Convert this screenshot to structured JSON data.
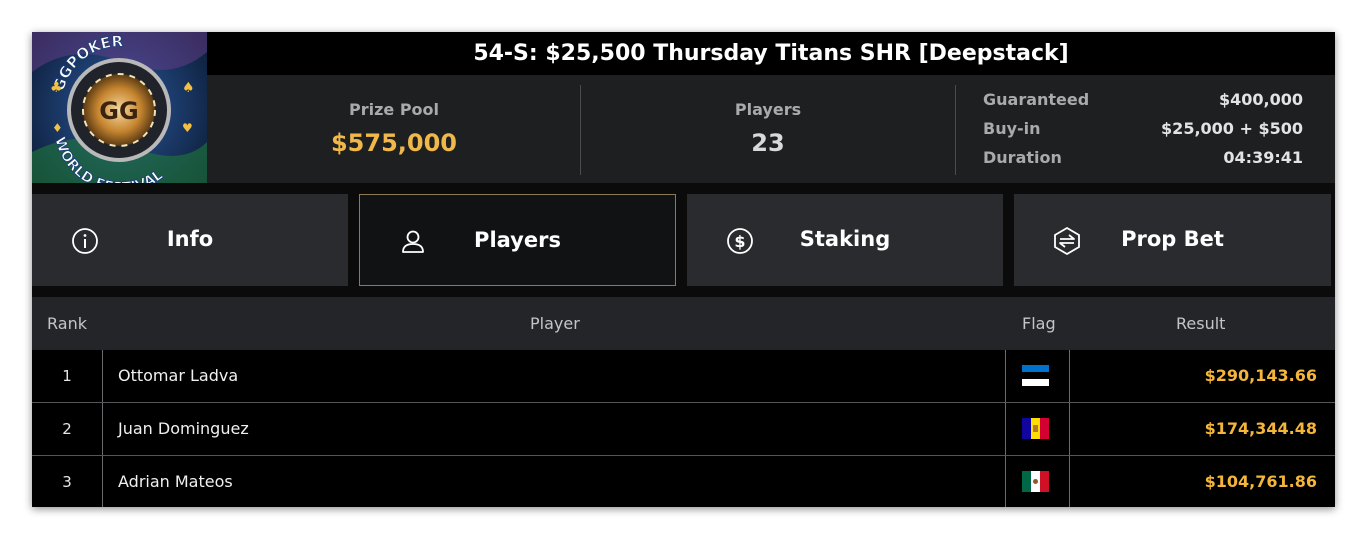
{
  "logo": {
    "text_top": "GGPOKER",
    "text_bottom": "WORLD FESTIVAL",
    "center": "GG"
  },
  "title": "54-S: $25,500 Thursday Titans SHR [Deepstack]",
  "stats": {
    "prize_pool_label": "Prize Pool",
    "prize_pool_value": "$575,000",
    "players_label": "Players",
    "players_value": "23",
    "details": [
      {
        "label": "Guaranteed",
        "value": "$400,000"
      },
      {
        "label": "Buy-in",
        "value": "$25,000 + $500"
      },
      {
        "label": "Duration",
        "value": "04:39:41"
      }
    ]
  },
  "tabs": [
    {
      "label": "Info",
      "icon": "info-icon"
    },
    {
      "label": "Players",
      "icon": "user-icon",
      "active": true
    },
    {
      "label": "Staking",
      "icon": "dollar-icon"
    },
    {
      "label": "Prop Bet",
      "icon": "prop-bet-icon"
    }
  ],
  "table": {
    "headers": {
      "rank": "Rank",
      "player": "Player",
      "flag": "Flag",
      "result": "Result"
    },
    "rows": [
      {
        "rank": "1",
        "player": "Ottomar Ladva",
        "flag": "estonia",
        "result": "$290,143.66"
      },
      {
        "rank": "2",
        "player": "Juan Dominguez",
        "flag": "andorra",
        "result": "$174,344.48"
      },
      {
        "rank": "3",
        "player": "Adrian Mateos",
        "flag": "mexico",
        "result": "$104,761.86"
      }
    ]
  },
  "colors": {
    "accent_gold": "#f4b53b",
    "prize_gold": "#f0b84a",
    "active_tab_border": "#8a7a55"
  }
}
